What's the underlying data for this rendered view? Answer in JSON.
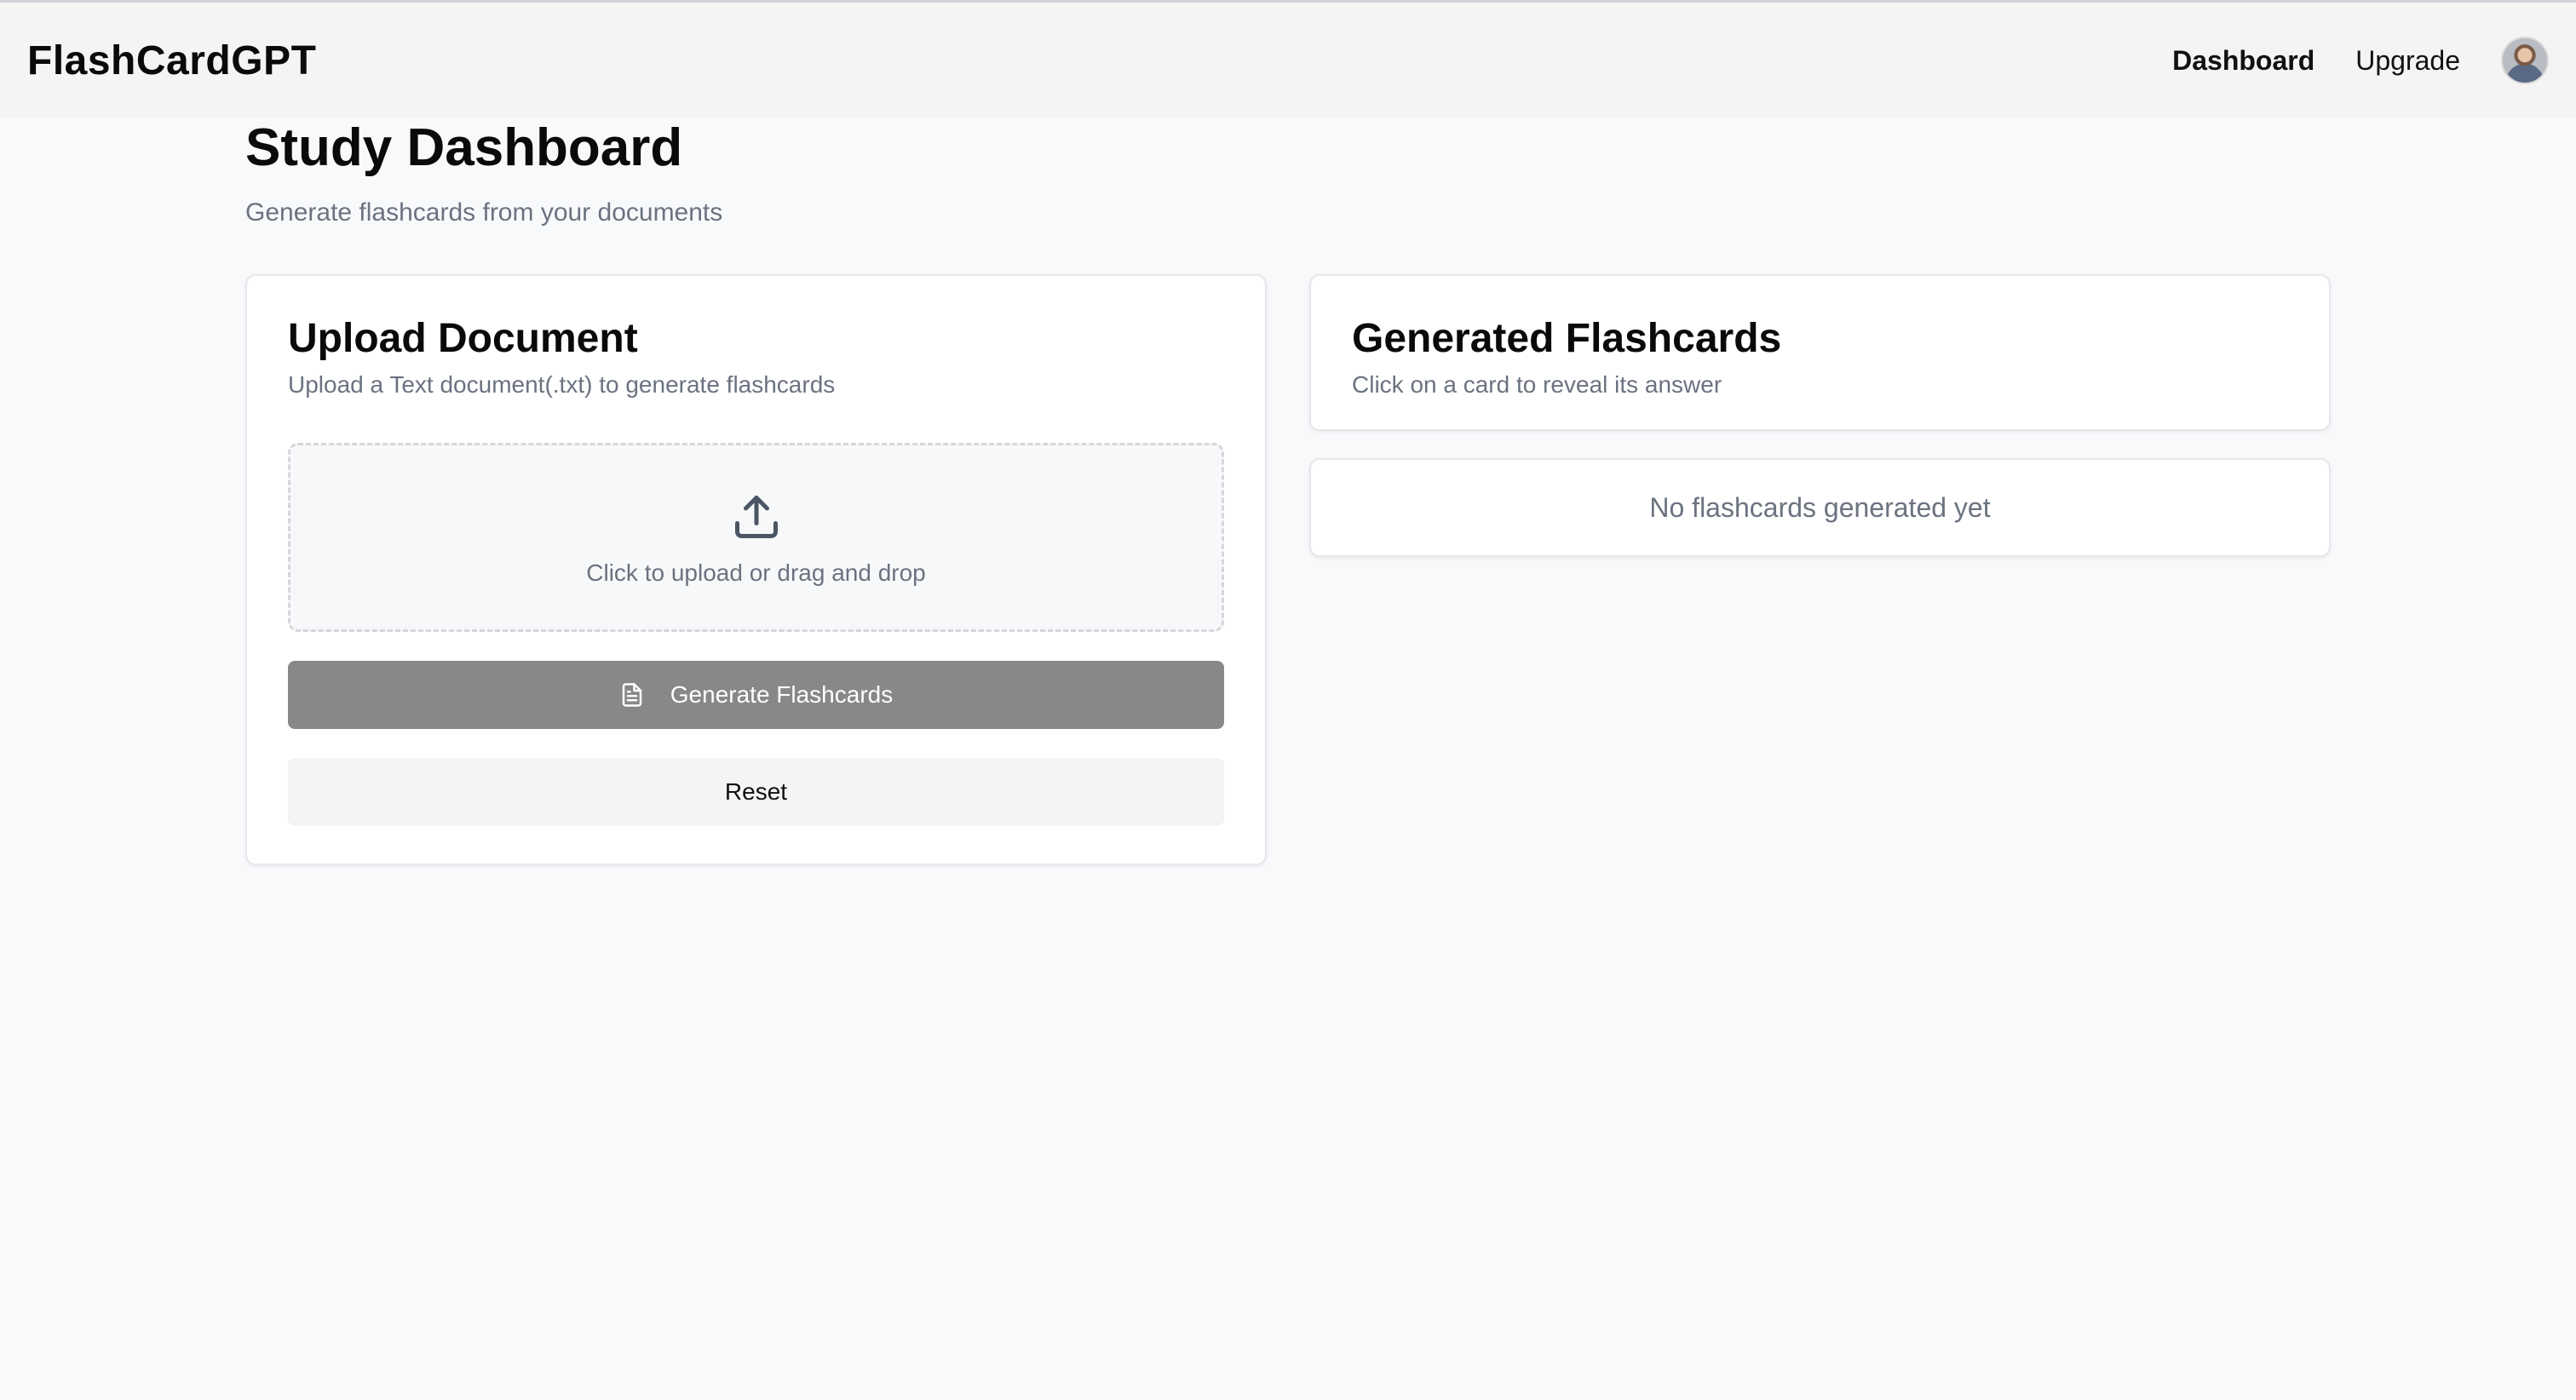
{
  "navbar": {
    "brand": "FlashCardGPT",
    "links": [
      {
        "label": "Dashboard",
        "active": true
      },
      {
        "label": "Upgrade",
        "active": false
      }
    ]
  },
  "page": {
    "title": "Study Dashboard",
    "subtitle": "Generate flashcards from your documents"
  },
  "upload": {
    "title": "Upload Document",
    "description": "Upload a Text document(.txt) to generate flashcards",
    "dropzone_text": "Click to upload or drag and drop",
    "generate_label": "Generate Flashcards",
    "reset_label": "Reset"
  },
  "flashcards": {
    "title": "Generated Flashcards",
    "description": "Click on a card to reveal its answer",
    "empty_text": "No flashcards generated yet"
  },
  "colors": {
    "background": "#f8f9fb",
    "navbar": "#f4f4f5",
    "generate_button": "#888888",
    "muted_text": "#6b7280"
  },
  "icons": [
    "upload-icon",
    "document-icon",
    "avatar"
  ]
}
